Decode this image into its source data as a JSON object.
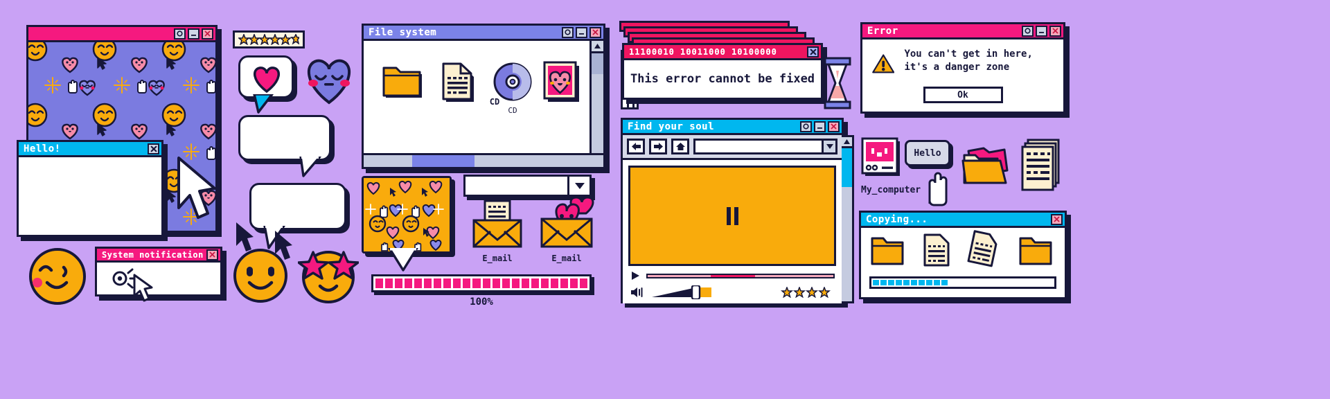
{
  "theme": {
    "background": "#c9a2f5",
    "ink": "#17173a",
    "pink": "#f5197f",
    "deep_pink": "#ef1560",
    "cyan": "#00b7ef",
    "periwinkle": "#7b83e8",
    "yellow": "#f9ab0c",
    "cream": "#fdf0d0",
    "wallpaper_blue": "#7b7be0"
  },
  "wallpaper_window": {
    "title": "",
    "name": "wallpaper-window",
    "buttons": [
      "maximize",
      "minimize",
      "close"
    ]
  },
  "hello_window": {
    "title": "Hello!",
    "buttons": [
      "close"
    ]
  },
  "system_notification": {
    "title": "System notification",
    "buttons": [
      "close"
    ]
  },
  "file_system": {
    "title": "File system",
    "buttons": [
      "maximize",
      "minimize",
      "close"
    ],
    "icons": [
      {
        "icon": "folder-icon",
        "label": ""
      },
      {
        "icon": "document-icon",
        "label": ""
      },
      {
        "icon": "cd-icon",
        "label": "CD"
      },
      {
        "icon": "image-heart-icon",
        "label": ""
      }
    ]
  },
  "binary_error": {
    "title": "11100010 10011000 10100000",
    "message": "This error cannot be fixed",
    "buttons": [
      "close"
    ],
    "stacked_copies": 5
  },
  "error_dialog": {
    "title": "Error",
    "message": "You can't get in here, it's a danger zone",
    "ok_label": "Ok",
    "icon": "warning-triangle-icon",
    "buttons": [
      "maximize",
      "minimize",
      "close"
    ]
  },
  "player": {
    "title": "Find your soul",
    "buttons": [
      "maximize",
      "minimize",
      "close"
    ],
    "nav": [
      "back-arrow-icon",
      "forward-arrow-icon",
      "home-icon"
    ],
    "address_value": "",
    "address_placeholder": "",
    "state_icon": "pause-icon",
    "transport_icon": "play-icon",
    "volume_icon": "speaker-icon",
    "rating_stars": 4,
    "seek_percent": 34
  },
  "copying": {
    "title": "Copying...",
    "buttons": [
      "close"
    ],
    "progress_segments": 14,
    "progress_filled": 10
  },
  "my_computer": {
    "label": "My_computer",
    "bubble_text": "Hello",
    "cursor": "hand-pointer-icon"
  },
  "star_rating_widget": {
    "stars": 6
  },
  "dropdown": {
    "value": "",
    "caret": "chevron-down-icon"
  },
  "loading_bar": {
    "percent_label": "100%",
    "segments": 22,
    "filled": 22
  },
  "email_icons": [
    {
      "label": "E_mail",
      "icon": "envelope-document-icon"
    },
    {
      "label": "E_mail",
      "icon": "envelope-heart-icon"
    }
  ],
  "speech_bubbles": [
    {
      "name": "bubble-heart",
      "content": "heart-icon"
    },
    {
      "name": "bubble-empty-1",
      "content": ""
    },
    {
      "name": "bubble-empty-2",
      "content": ""
    },
    {
      "name": "bubble-pattern",
      "content": "pattern-swatch"
    }
  ],
  "decorations": [
    "hourglass-icon",
    "sleepy-heart-face",
    "wink-smiley",
    "smile-smiley",
    "star-eyes-smiley",
    "folder-stack-icon",
    "document-stack-icon",
    "folder-icon",
    "document-icon",
    "cursor-arrow-icon"
  ]
}
